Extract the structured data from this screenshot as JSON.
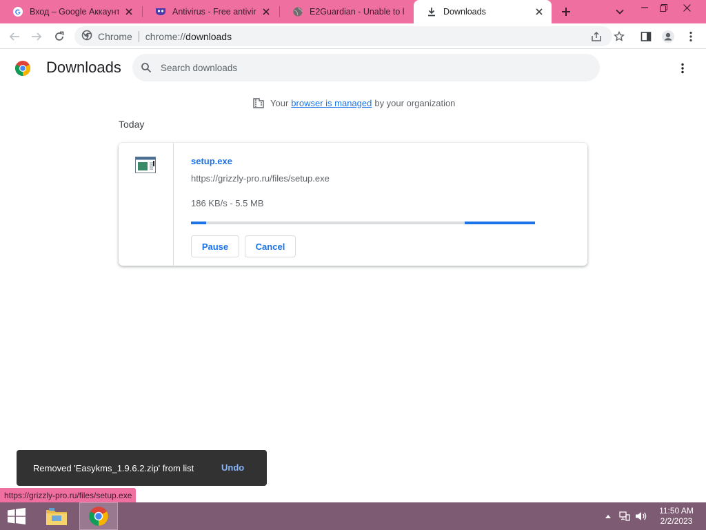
{
  "tabs": [
    {
      "title": "Вход – Google Аккаунты",
      "favicon": "google-g-icon"
    },
    {
      "title": "Antivirus - Free antivirus",
      "favicon": "antivirus-mask-icon"
    },
    {
      "title": "E2Guardian - Unable to l",
      "favicon": "globe-icon"
    },
    {
      "title": "Downloads",
      "favicon": "download-icon",
      "active": true
    }
  ],
  "toolbar": {
    "site_label": "Chrome",
    "url_scheme": "chrome://",
    "url_host": "downloads"
  },
  "downloads_page": {
    "title": "Downloads",
    "search_placeholder": "Search downloads",
    "managed_prefix": "Your",
    "managed_link": "browser is managed",
    "managed_suffix": "by your organization",
    "section_today": "Today"
  },
  "download_item": {
    "file_name": "setup.exe",
    "url": "https://grizzly-pro.ru/files/setup.exe",
    "status": "186 KB/s - 5.5 MB",
    "pause_label": "Pause",
    "cancel_label": "Cancel",
    "progress_state": "indeterminate"
  },
  "toast": {
    "message": "Removed 'Easykms_1.9.6.2.zip' from list",
    "action": "Undo"
  },
  "status_bar_url": "https://grizzly-pro.ru/files/setup.exe",
  "taskbar": {
    "time": "11:50 AM",
    "date": "2/2/2023",
    "apps": [
      "file-explorer-icon",
      "chrome-icon"
    ]
  },
  "colors": {
    "tabstrip": "#ee6fa0",
    "accent": "#1a73e8",
    "taskbar": "#7c5b73",
    "toast": "#323232"
  }
}
